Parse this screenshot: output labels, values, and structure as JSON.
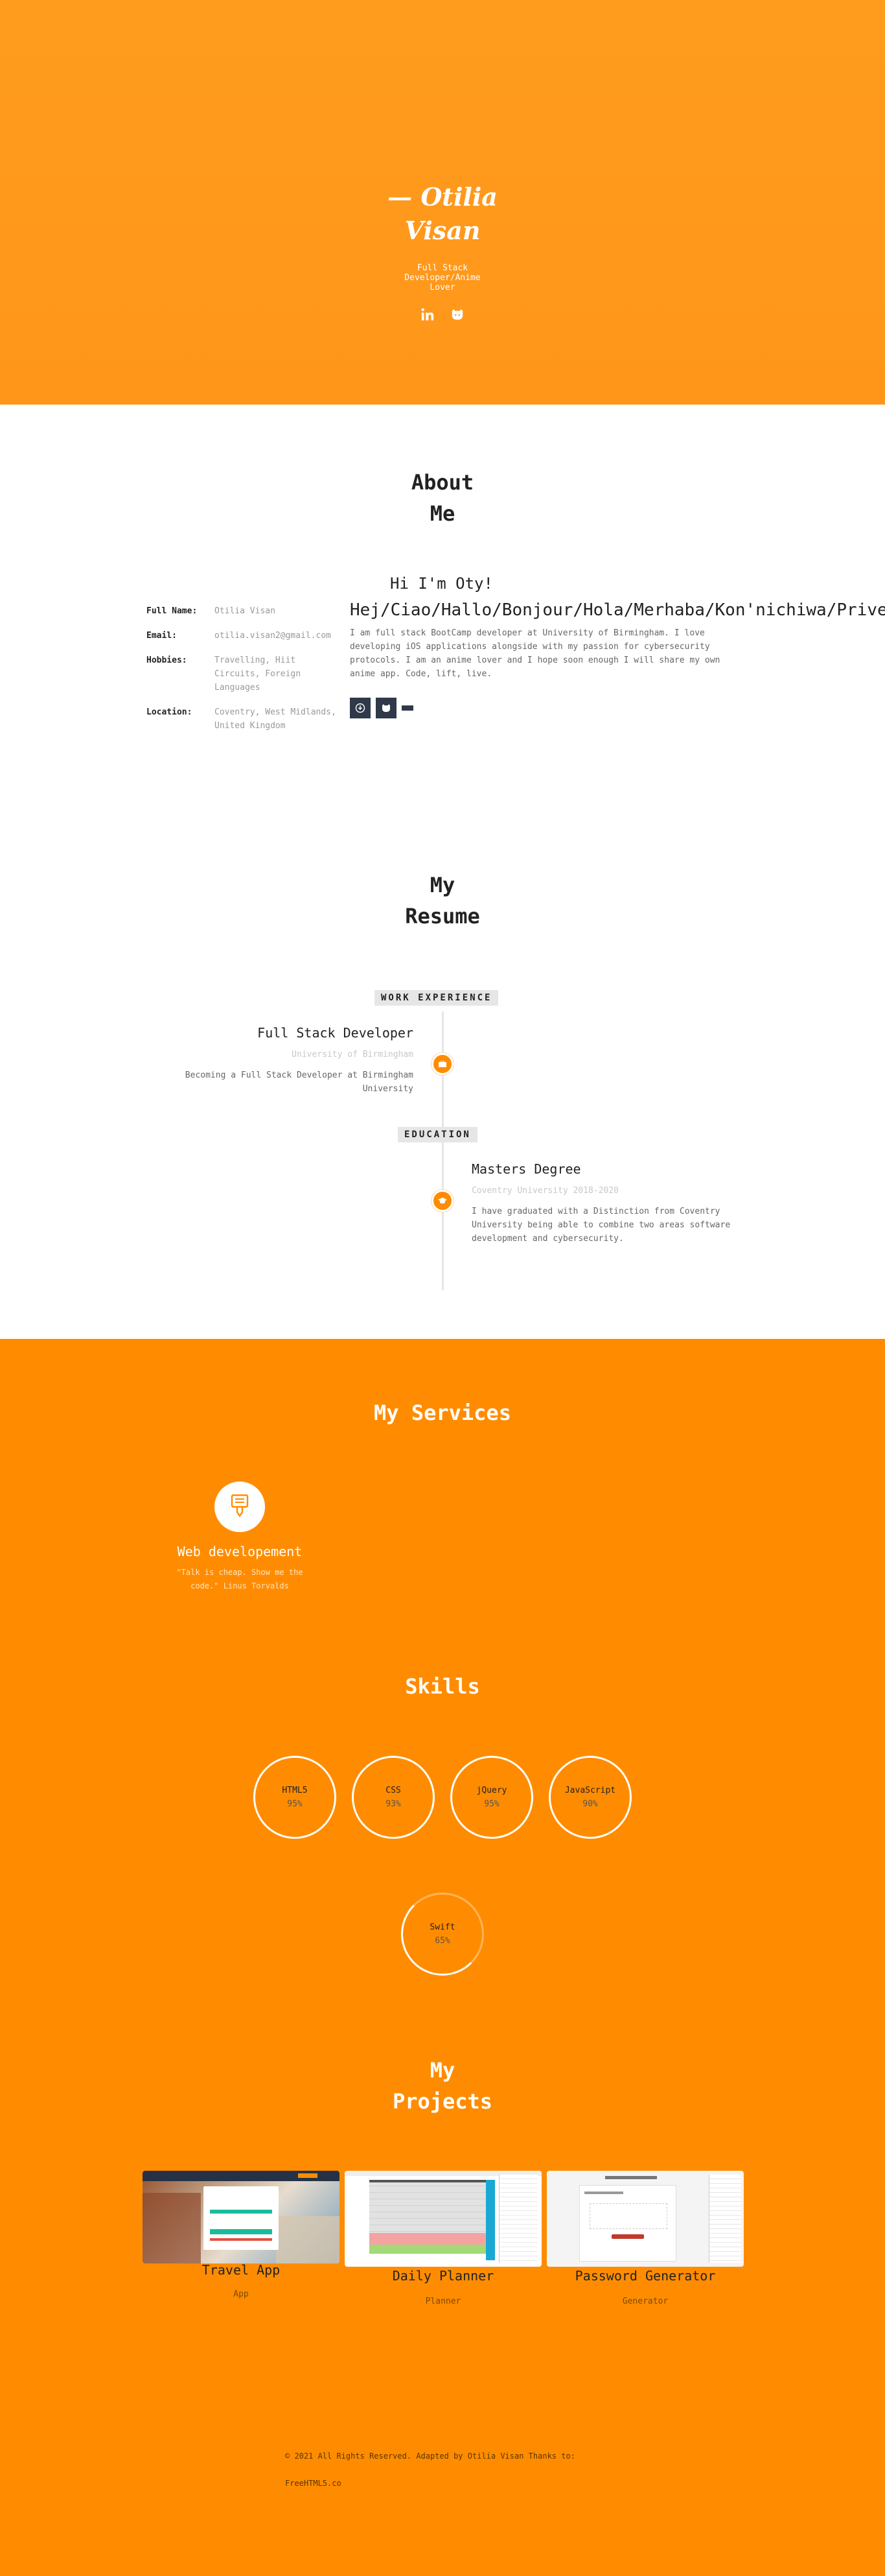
{
  "hero": {
    "name_line1": "Otilia",
    "name_line2": "Visan",
    "subtitle": "Full Stack Developer/Anime Lover",
    "social_icons": [
      "linkedin-icon",
      "github-icon"
    ]
  },
  "about": {
    "title_line1": "About",
    "title_line2": "Me",
    "info": [
      {
        "label": "Full Name:",
        "value": "Otilia Visan"
      },
      {
        "label": "Email:",
        "value": "otilia.visan2@gmail.com"
      },
      {
        "label": "Hobbies:",
        "value": "Travelling, Hiit Circuits, Foreign Languages"
      },
      {
        "label": "Location:",
        "value": "Coventry, West Midlands, United Kingdom"
      }
    ],
    "hi": "Hi I'm Oty!",
    "greetings": "Hej/Ciao/Hallo/Bonjour/Hola/Merhaba/Kon'nichiwa/Privet",
    "description": "I am full stack BootCamp developer at University of Birmingham. I love developing iOS applications alongside with my passion for cybersecurity protocols. I am an anime lover and I hope soon enough I will share my own anime app. Code, lift, live.",
    "icons": [
      "download-icon",
      "github-icon",
      "bar-icon"
    ]
  },
  "resume": {
    "title_line1": "My",
    "title_line2": "Resume",
    "work_badge": "WORK EXPERIENCE",
    "work": {
      "title": "Full Stack Developer",
      "org": "University of Birmingham",
      "desc": "Becoming a Full Stack Developer at Birmingham University"
    },
    "edu_badge": "EDUCATION",
    "edu": {
      "title": "Masters Degree",
      "org": "Coventry University 2018-2020",
      "desc": "I have graduated with a Distinction from Coventry University being able to combine two areas software development and cybersecurity."
    }
  },
  "services": {
    "title": "My Services",
    "item": {
      "name": "Web developement",
      "quote": "\"Talk is cheap. Show me the code.\" Linus Torvalds"
    }
  },
  "skills": {
    "title": "Skills",
    "items": [
      {
        "name": "HTML5",
        "percent": "95%"
      },
      {
        "name": "CSS",
        "percent": "93%"
      },
      {
        "name": "jQuery",
        "percent": "95%"
      },
      {
        "name": "JavaScript",
        "percent": "90%"
      },
      {
        "name": "Swift",
        "percent": "65%"
      }
    ]
  },
  "projects": {
    "title_line1": "My",
    "title_line2": "Projects",
    "items": [
      {
        "name": "Travel App",
        "category": "App"
      },
      {
        "name": "Daily Planner",
        "category": "Planner"
      },
      {
        "name": "Password Generator",
        "category": "Generator"
      }
    ]
  },
  "footer": {
    "copyright": "© 2021 All Rights Reserved. Adapted by Otilia Visan Thanks to:",
    "link": "FreeHTML5.co"
  },
  "colors": {
    "accent": "#ff8c00",
    "hero": "#ff9c1d",
    "dark_icon": "#303949"
  }
}
